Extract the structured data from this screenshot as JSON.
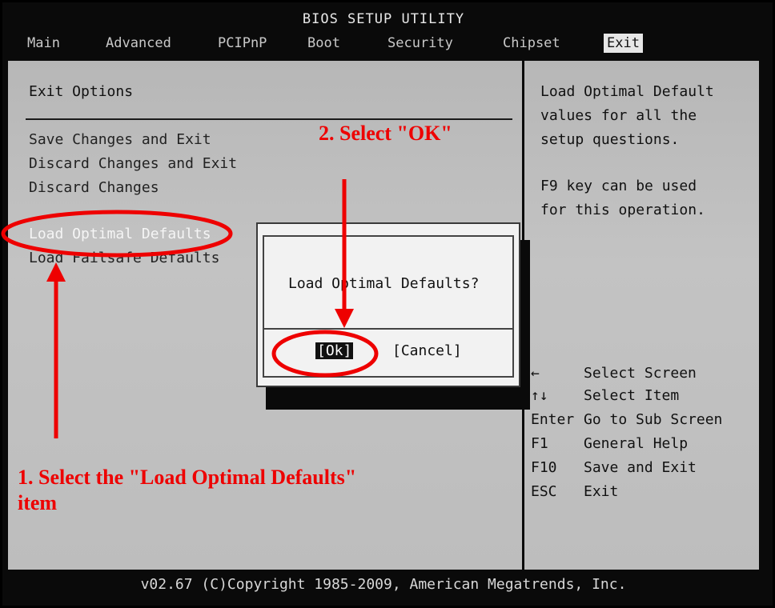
{
  "title": "BIOS SETUP UTILITY",
  "menu": [
    "Main",
    "Advanced",
    "PCIPnP",
    "Boot",
    "Security",
    "Chipset",
    "Exit"
  ],
  "active_menu": "Exit",
  "exit_options": {
    "heading": "Exit Options",
    "items": [
      "Save Changes and Exit",
      "Discard Changes and Exit",
      "Discard Changes",
      "Load Optimal Defaults",
      "Load Failsafe Defaults"
    ],
    "selected": "Load Optimal Defaults"
  },
  "help": {
    "lines": [
      "Load Optimal Default",
      "values for all the",
      "setup questions.",
      "",
      "F9 key can be used",
      "for this operation."
    ]
  },
  "keys": [
    {
      "key": "←",
      "desc": "Select Screen"
    },
    {
      "key": "↑↓",
      "desc": "Select Item"
    },
    {
      "key": "Enter",
      "desc": "Go to Sub Screen"
    },
    {
      "key": "F1",
      "desc": "General Help"
    },
    {
      "key": "F10",
      "desc": "Save and Exit"
    },
    {
      "key": "ESC",
      "desc": "Exit"
    }
  ],
  "dialog": {
    "question": "Load Optimal Defaults?",
    "ok": "[Ok]",
    "cancel": "[Cancel]"
  },
  "status": "v02.67 (C)Copyright 1985-2009, American Megatrends, Inc.",
  "annotations": {
    "step1_line1": "1. Select the \"Load Optimal Defaults\"",
    "step1_line2": "item",
    "step2": "2. Select \"OK\""
  },
  "colors": {
    "annotation": "#ee0000",
    "screen_bg": "#bdbdbd",
    "bar_bg": "#0a0a0a"
  }
}
